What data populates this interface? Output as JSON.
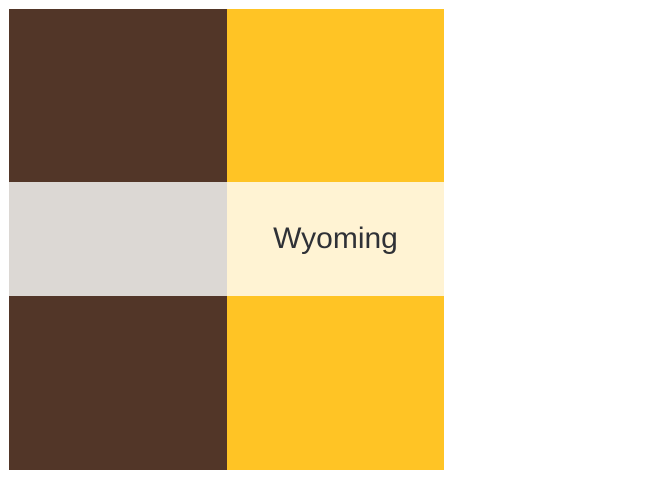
{
  "label": "Wyoming",
  "colors": {
    "primary": "#523628",
    "secondary": "#ffc425",
    "primary_tint": "#dcd8d4",
    "secondary_tint": "#fff3d3",
    "label_text": "#2f3136"
  }
}
